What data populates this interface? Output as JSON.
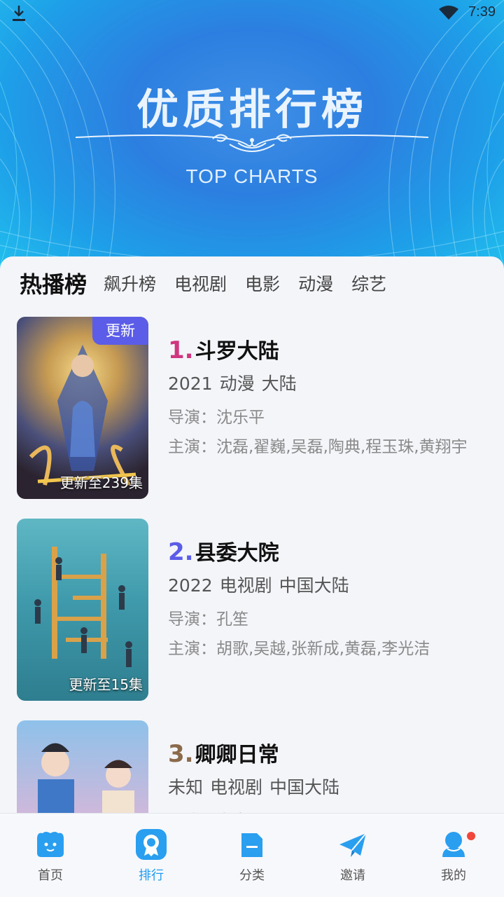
{
  "status_bar": {
    "time": "7:39"
  },
  "hero": {
    "title": "优质排行榜",
    "subtitle": "TOP CHARTS"
  },
  "tabs": [
    {
      "label": "热播榜",
      "active": true
    },
    {
      "label": "飙升榜",
      "active": false
    },
    {
      "label": "电视剧",
      "active": false
    },
    {
      "label": "电影",
      "active": false
    },
    {
      "label": "动漫",
      "active": false
    },
    {
      "label": "综艺",
      "active": false
    }
  ],
  "list": [
    {
      "rank": "1.",
      "rank_color": "#d0357f",
      "title": "斗罗大陆",
      "year": "2021",
      "genre": "动漫",
      "region": "大陆",
      "director": "导演：沈乐平",
      "cast": "主演：沈磊,翟巍,吴磊,陶典,程玉珠,黄翔宇",
      "badge": "更新",
      "episode": "更新至239集"
    },
    {
      "rank": "2.",
      "rank_color": "#5b5ce8",
      "title": "县委大院",
      "year": "2022",
      "genre": "电视剧",
      "region": "中国大陆",
      "director": "导演：孔笙",
      "cast": "主演：胡歌,吴越,张新成,黄磊,李光洁",
      "badge": "",
      "episode": "更新至15集"
    },
    {
      "rank": "3.",
      "rank_color": "#8a6a4a",
      "title": "卿卿日常",
      "year": "未知",
      "genre": "电视剧",
      "region": "中国大陆",
      "director": "导演：李青天",
      "cast": "",
      "badge": "",
      "episode": ""
    }
  ],
  "nav": [
    {
      "label": "首页",
      "icon": "home-icon"
    },
    {
      "label": "排行",
      "icon": "ranking-icon",
      "active": true
    },
    {
      "label": "分类",
      "icon": "category-icon"
    },
    {
      "label": "邀请",
      "icon": "invite-icon"
    },
    {
      "label": "我的",
      "icon": "profile-icon",
      "badge_dot": true
    }
  ],
  "colors": {
    "accent": "#1e9bf0",
    "badge": "#5b5ce8",
    "notify_dot": "#f2463b"
  }
}
